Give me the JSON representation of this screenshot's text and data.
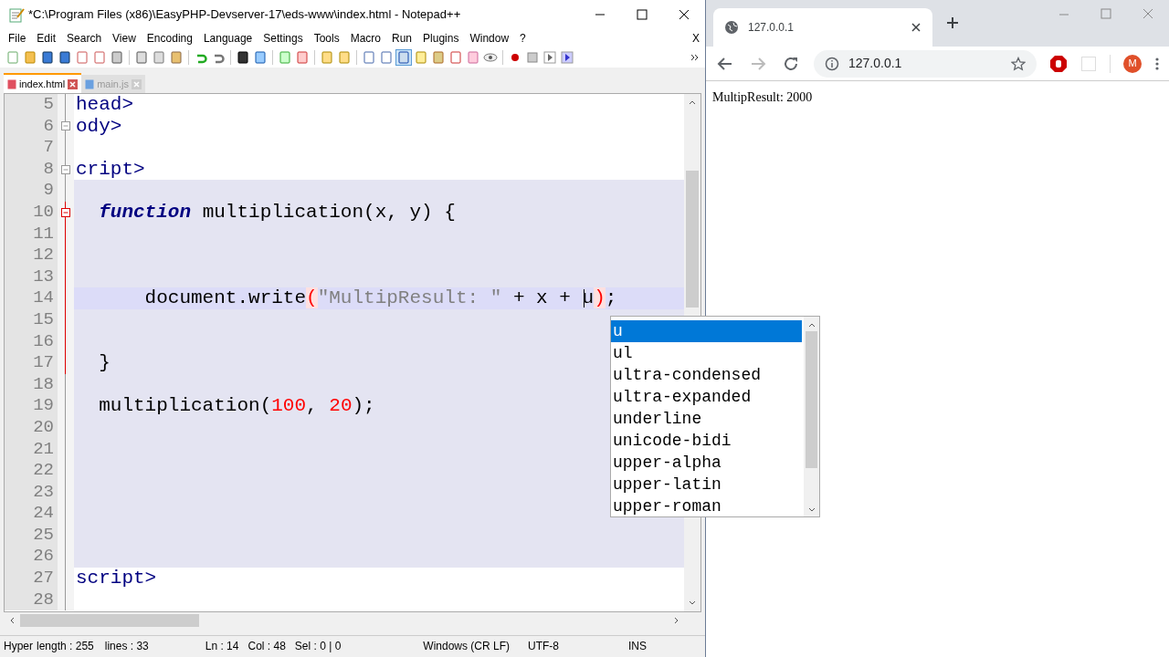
{
  "editor_window": {
    "title": "*C:\\Program Files (x86)\\EasyPHP-Devserver-17\\eds-www\\index.html - Notepad++",
    "menu": [
      "File",
      "Edit",
      "Search",
      "View",
      "Encoding",
      "Language",
      "Settings",
      "Tools",
      "Macro",
      "Run",
      "Plugins",
      "Window",
      "?"
    ],
    "menu_close": "X",
    "tabs": [
      {
        "label": "index.html",
        "selected": true
      },
      {
        "label": "main.js",
        "selected": false
      }
    ],
    "lines": [
      {
        "number": "5",
        "fold_button": false,
        "fold_active": false,
        "current": false,
        "embedded": false,
        "tokens": [
          {
            "kind": "tag",
            "text": "head>"
          }
        ]
      },
      {
        "number": "6",
        "fold_button": true,
        "fold_active": false,
        "current": false,
        "embedded": false,
        "tokens": [
          {
            "kind": "tag",
            "text": "ody>"
          }
        ]
      },
      {
        "number": "7",
        "fold_button": false,
        "fold_active": false,
        "current": false,
        "embedded": false
      },
      {
        "number": "8",
        "fold_button": true,
        "fold_active": false,
        "current": false,
        "embedded": false,
        "tokens": [
          {
            "kind": "tag",
            "text": "cript>"
          }
        ]
      },
      {
        "number": "9",
        "fold_button": false,
        "fold_active": false,
        "current": false,
        "embedded": true
      },
      {
        "number": "10",
        "fold_button": true,
        "fold_active": true,
        "current": false,
        "embedded": true,
        "tokens": [
          {
            "kind": "keyword",
            "text": "  function"
          },
          {
            "kind": "plain",
            "text": " multiplication(x, y) {"
          }
        ]
      },
      {
        "number": "11",
        "fold_button": false,
        "fold_active": true,
        "current": false,
        "embedded": true
      },
      {
        "number": "12",
        "fold_button": false,
        "fold_active": true,
        "current": false,
        "embedded": true
      },
      {
        "number": "13",
        "fold_button": false,
        "fold_active": true,
        "current": false,
        "embedded": true
      },
      {
        "number": "14",
        "fold_button": false,
        "fold_active": true,
        "current": true,
        "embedded": true,
        "tokens": [
          {
            "kind": "plain",
            "text": "      document.write"
          },
          {
            "kind": "brace",
            "text": "("
          },
          {
            "kind": "string",
            "text": "\"MultipResult: \""
          },
          {
            "kind": "plain",
            "text": " + x + u"
          },
          {
            "kind": "brace",
            "text": ")"
          },
          {
            "kind": "plain",
            "text": ";"
          }
        ]
      },
      {
        "number": "15",
        "fold_button": false,
        "fold_active": true,
        "current": false,
        "embedded": true
      },
      {
        "number": "16",
        "fold_button": false,
        "fold_active": true,
        "current": false,
        "embedded": true
      },
      {
        "number": "17",
        "fold_button": false,
        "fold_active": true,
        "current": false,
        "embedded": true,
        "tokens": [
          {
            "kind": "plain",
            "text": "  }"
          }
        ]
      },
      {
        "number": "18",
        "fold_button": false,
        "fold_active": false,
        "current": false,
        "embedded": true
      },
      {
        "number": "19",
        "fold_button": false,
        "fold_active": false,
        "current": false,
        "embedded": true,
        "tokens": [
          {
            "kind": "plain",
            "text": "  multiplication("
          },
          {
            "kind": "number",
            "text": "100"
          },
          {
            "kind": "plain",
            "text": ", "
          },
          {
            "kind": "number",
            "text": "20"
          },
          {
            "kind": "plain",
            "text": ");"
          }
        ]
      },
      {
        "number": "20",
        "fold_button": false,
        "fold_active": false,
        "current": false,
        "embedded": true
      },
      {
        "number": "21",
        "fold_button": false,
        "fold_active": false,
        "current": false,
        "embedded": true
      },
      {
        "number": "22",
        "fold_button": false,
        "fold_active": false,
        "current": false,
        "embedded": true
      },
      {
        "number": "23",
        "fold_button": false,
        "fold_active": false,
        "current": false,
        "embedded": true
      },
      {
        "number": "24",
        "fold_button": false,
        "fold_active": false,
        "current": false,
        "embedded": true
      },
      {
        "number": "25",
        "fold_button": false,
        "fold_active": false,
        "current": false,
        "embedded": true
      },
      {
        "number": "26",
        "fold_button": false,
        "fold_active": false,
        "current": false,
        "embedded": true
      },
      {
        "number": "27",
        "fold_button": false,
        "fold_active": false,
        "current": false,
        "embedded": false,
        "tokens": [
          {
            "kind": "tag",
            "text": "script>"
          }
        ]
      },
      {
        "number": "28",
        "fold_button": false,
        "fold_active": false,
        "current": false,
        "embedded": false
      }
    ],
    "autocomplete": [
      {
        "label": "u",
        "selected": true
      },
      {
        "label": "ul",
        "selected": false
      },
      {
        "label": "ultra-condensed",
        "selected": false
      },
      {
        "label": "ultra-expanded",
        "selected": false
      },
      {
        "label": "underline",
        "selected": false
      },
      {
        "label": "unicode-bidi",
        "selected": false
      },
      {
        "label": "upper-alpha",
        "selected": false
      },
      {
        "label": "upper-latin",
        "selected": false
      },
      {
        "label": "upper-roman",
        "selected": false
      }
    ],
    "status_bar": [
      "Hyper",
      "length : 255",
      "lines : 33",
      "Ln : 14",
      "Col : 48",
      "Sel : 0 | 0",
      "Windows (CR LF)",
      "UTF-8",
      "INS"
    ]
  },
  "browser_window": {
    "tab": {
      "title": "127.0.0.1"
    },
    "address": "127.0.0.1",
    "avatar": "M",
    "content": "MultipResult: 2000"
  }
}
